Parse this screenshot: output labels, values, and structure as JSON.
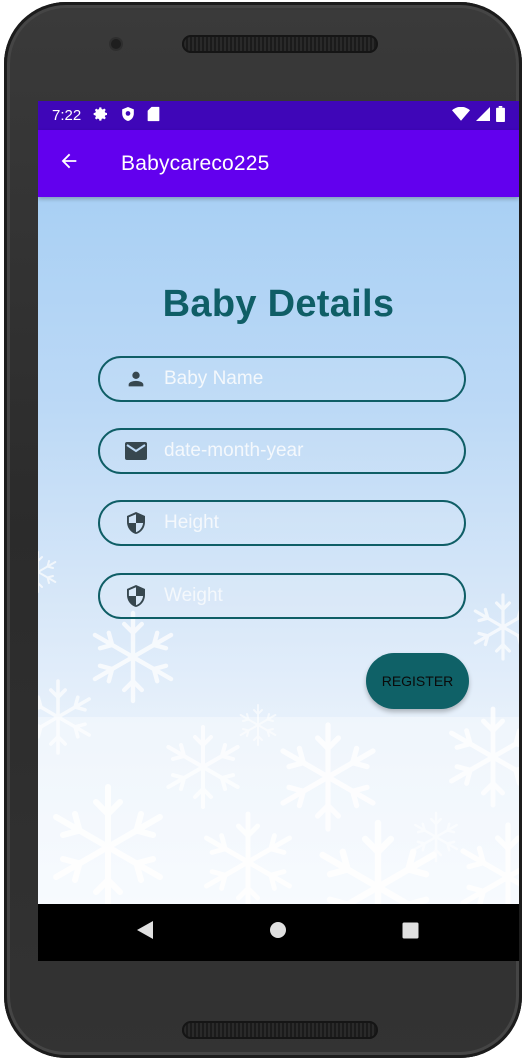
{
  "status_bar": {
    "time": "7:22",
    "left_icons": [
      "settings-icon",
      "shield-status-icon",
      "sd-card-icon"
    ],
    "right_icons": [
      "wifi-icon",
      "cell-signal-icon",
      "battery-icon"
    ]
  },
  "app_bar": {
    "title": "Babycareco225",
    "back_icon": "arrow-left-icon"
  },
  "form": {
    "title": "Baby Details",
    "fields": [
      {
        "placeholder": "Baby Name",
        "value": "",
        "icon": "person-icon"
      },
      {
        "placeholder": "date-month-year",
        "value": "",
        "icon": "email-icon"
      },
      {
        "placeholder": "Height",
        "value": "",
        "icon": "shield-icon"
      },
      {
        "placeholder": "Weight",
        "value": "",
        "icon": "shield-icon"
      }
    ],
    "register_label": "REGISTER"
  },
  "nav_bar": {
    "buttons": [
      "back-triangle-icon",
      "home-circle-icon",
      "recents-square-icon"
    ]
  },
  "colors": {
    "status_bar": "#3f06b8",
    "app_bar": "#6200ee",
    "accent_teal": "#0f5e66",
    "button": "#0f6167"
  }
}
